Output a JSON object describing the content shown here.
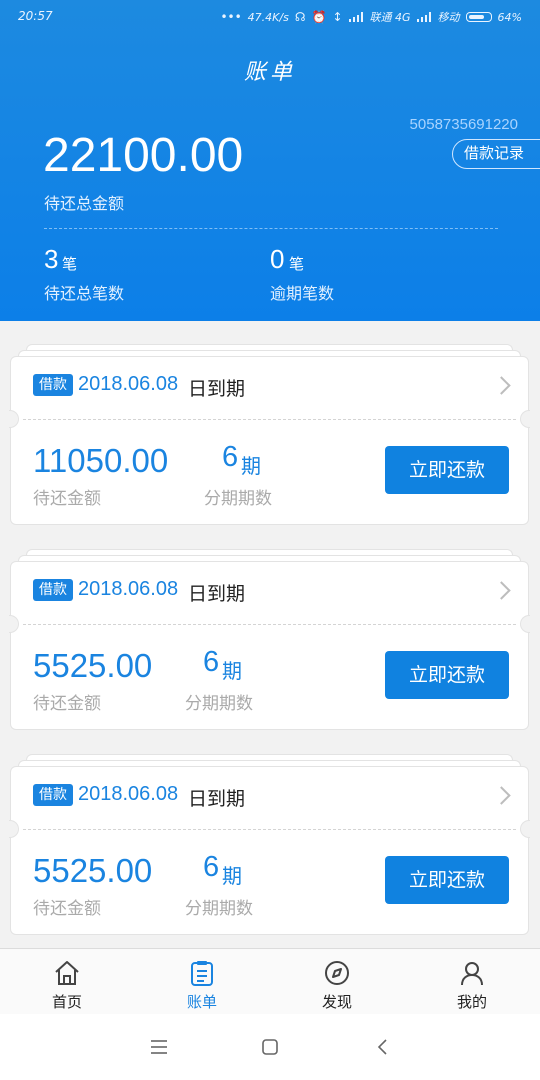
{
  "status_bar": {
    "time": "20:57",
    "dots": "•••",
    "speed": "47.4K/s",
    "carrier1": "联通 4G",
    "carrier2": "移动",
    "battery": "64%"
  },
  "header": {
    "title": "账单",
    "account_number": "5058735691220",
    "record_button": "借款记录",
    "total_amount": "22100.00",
    "total_label": "待还总金额",
    "pending_count": "3",
    "pending_unit": "笔",
    "pending_label": "待还总笔数",
    "overdue_count": "0",
    "overdue_unit": "笔",
    "overdue_label": "逾期笔数"
  },
  "bills": [
    {
      "badge": "借款",
      "due_date": "2018.06.08",
      "due_suffix": "日到期",
      "amount": "11050.00",
      "amount_label": "待还金额",
      "periods": "6",
      "periods_unit": "期",
      "periods_label": "分期期数",
      "pay_button": "立即还款"
    },
    {
      "badge": "借款",
      "due_date": "2018.06.08",
      "due_suffix": "日到期",
      "amount": "5525.00",
      "amount_label": "待还金额",
      "periods": "6",
      "periods_unit": "期",
      "periods_label": "分期期数",
      "pay_button": "立即还款"
    },
    {
      "badge": "借款",
      "due_date": "2018.06.08",
      "due_suffix": "日到期",
      "amount": "5525.00",
      "amount_label": "待还金额",
      "periods": "6",
      "periods_unit": "期",
      "periods_label": "分期期数",
      "pay_button": "立即还款"
    }
  ],
  "tabs": [
    {
      "label": "首页",
      "icon": "home-icon",
      "active": false
    },
    {
      "label": "账单",
      "icon": "bill-icon",
      "active": true
    },
    {
      "label": "发现",
      "icon": "compass-icon",
      "active": false
    },
    {
      "label": "我的",
      "icon": "user-icon",
      "active": false
    }
  ],
  "colors": {
    "accent": "#1a84e0",
    "header": "#1d8ae0"
  }
}
